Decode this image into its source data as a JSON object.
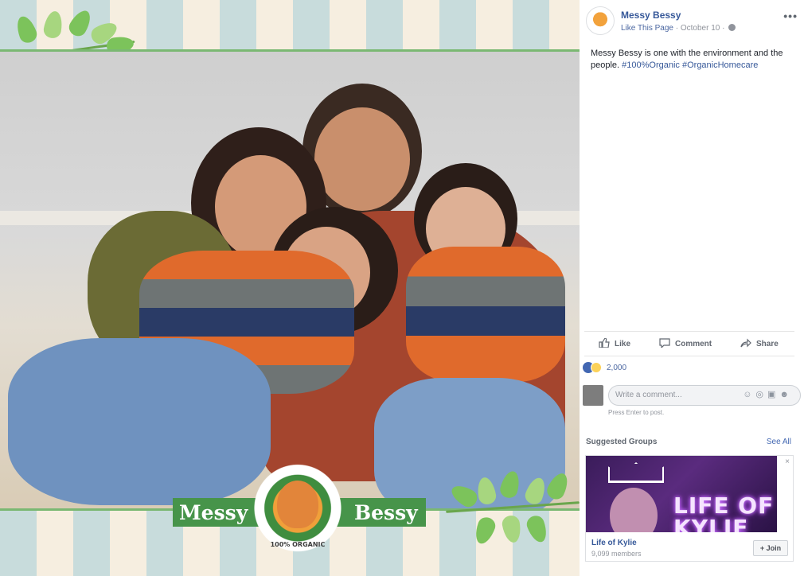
{
  "post": {
    "page_name": "Messy Bessy",
    "like_link": "Like This Page",
    "date": "October 10",
    "separator": "·",
    "more_icon": "more-horizontal-icon",
    "text_main": "Messy Bessy is one with the environment and the people.",
    "hashtags": "#100%Organic #OrganicHomecare"
  },
  "photo": {
    "brand_left": "Messy",
    "brand_right": "Bessy",
    "badge_text": "100% ORGANIC",
    "colors": {
      "stripe_blue": "#c8dcdc",
      "stripe_cream": "#f6eee0",
      "brand_green": "#47944a"
    }
  },
  "actions": {
    "like": "Like",
    "comment": "Comment",
    "share": "Share"
  },
  "reactions": {
    "count": "2,000"
  },
  "comment": {
    "placeholder": "Write a comment...",
    "hint": "Press Enter to post."
  },
  "suggested": {
    "title": "Suggested Groups",
    "see_all": "See All",
    "group": {
      "image_text_line1": "LIFE OF",
      "image_text_line2": "KYLIE",
      "name": "Life of Kylie",
      "members": "9,099 members",
      "join": "+ Join",
      "close": "×"
    }
  }
}
